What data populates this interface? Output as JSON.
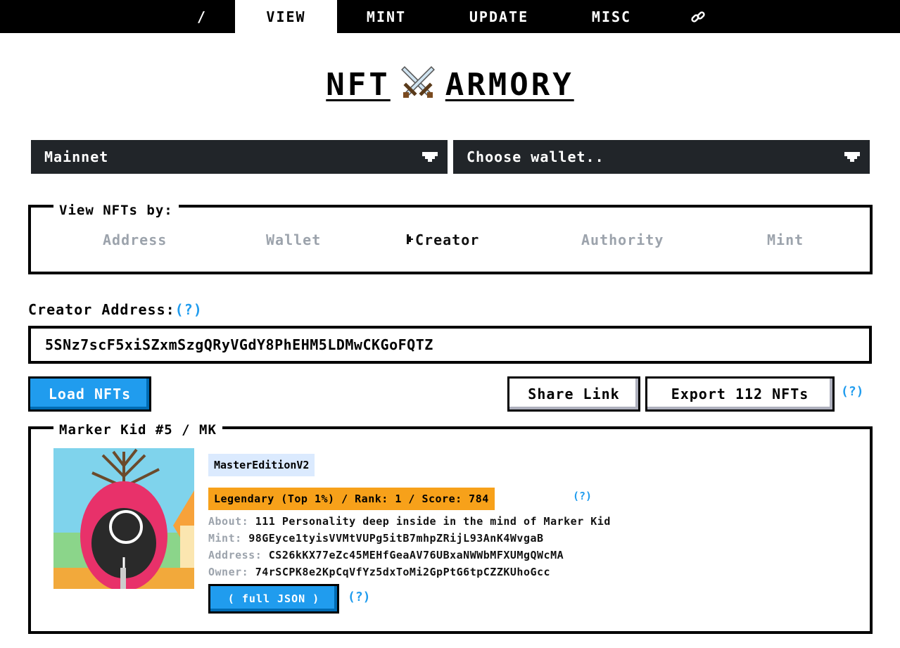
{
  "nav": {
    "items": [
      {
        "label": "/"
      },
      {
        "label": "VIEW"
      },
      {
        "label": "MINT"
      },
      {
        "label": "UPDATE"
      },
      {
        "label": "MISC"
      }
    ],
    "link_icon": "link-icon"
  },
  "title": {
    "left": "NFT",
    "right": "ARMORY",
    "icon": "crossed-swords-icon"
  },
  "network_select": {
    "value": "Mainnet"
  },
  "wallet_select": {
    "value": "Choose wallet.."
  },
  "view_by": {
    "legend": "View NFTs by:",
    "options": [
      "Address",
      "Wallet",
      "Creator",
      "Authority",
      "Mint"
    ],
    "selected": "Creator"
  },
  "creator": {
    "label": "Creator Address:",
    "help": "(?)",
    "value": "5SNz7scF5xiSZxmSzgQRyVGdY8PhEHM5LDMwCKGoFQTZ"
  },
  "buttons": {
    "load": "Load NFTs",
    "share": "Share Link",
    "export": "Export 112 NFTs",
    "export_help": "(?)"
  },
  "nft": {
    "name": "Marker Kid #5 / MK",
    "edition_tag": "MasterEditionV2",
    "rarity": "Legendary (Top 1%) / Rank: 1 / Score: 784",
    "rarity_help": "(?)",
    "about_key": "About:",
    "about": "111 Personality deep inside in the mind of Marker Kid",
    "mint_key": "Mint:",
    "mint": "98GEyce1tyisVVMtVUPg5itB7mhpZRijL93AnK4WvgaB",
    "address_key": "Address:",
    "address": "CS26kKX77eZc45MEHfGeaAV76UBxaNWWbMFXUMgQWcMA",
    "owner_key": "Owner:",
    "owner": "74rSCPK8e2KpCqVfYz5dxToMi2GpPtG6tpCZZKUhoGcc",
    "json_button": "( full JSON )",
    "json_help": "(?)"
  },
  "colors": {
    "nav_bg": "#000000",
    "select_bg": "#212529",
    "primary": "#209cee",
    "rarity_bg": "#f7a11a",
    "edition_bg": "#dbeafe",
    "muted": "#9ca3ac"
  }
}
